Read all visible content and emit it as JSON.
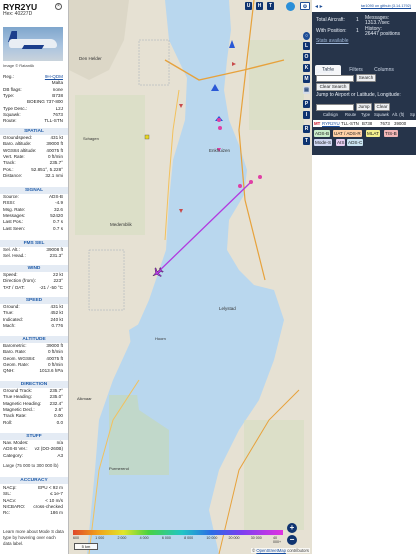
{
  "info": {
    "callsign": "RYR2YU",
    "hex_label": "Hex:",
    "hex": "40227D",
    "photo_credit": "Image © Ratan6k",
    "top_rows": [
      {
        "k": "Reg.:",
        "v": "9H-QDM"
      },
      {
        "k": "",
        "v": "Malta"
      },
      {
        "k": "DB flags:",
        "v": "none"
      },
      {
        "k": "Type:",
        "v": "B738"
      },
      {
        "k": "",
        "v": "BOEING 737-800"
      },
      {
        "k": "Type Desc.:",
        "v": "L2J"
      },
      {
        "k": "Squawk:",
        "v": "7673"
      },
      {
        "k": "Route:",
        "v": "TLL-STN"
      }
    ],
    "sections": {
      "spatial": "SPATIAL",
      "signal": "SIGNAL",
      "fms_sel": "FMS SEL",
      "wind": "WIND",
      "speed": "SPEED",
      "altitude": "ALTITUDE",
      "direction": "DIRECTION",
      "stuff": "STUFF",
      "accuracy": "ACCURACY"
    },
    "spatial": [
      {
        "k": "Groundspeed:",
        "v": "431 kt"
      },
      {
        "k": "Baro. altitude:",
        "v": "39000 ft"
      },
      {
        "k": "WGS84 altitude:",
        "v": "40075 ft"
      },
      {
        "k": "Vert. Rate:",
        "v": "0 ft/min"
      },
      {
        "k": "Track:",
        "v": "235.7°"
      },
      {
        "k": "Pos.:",
        "v": "52.851°, 5.228°"
      },
      {
        "k": "Distance:",
        "v": "32.1 nmi"
      }
    ],
    "signal": [
      {
        "k": "Source:",
        "v": "ADS-B"
      },
      {
        "k": "RSSI:",
        "v": "-4.9"
      },
      {
        "k": "Msg. Rate:",
        "v": "32.6"
      },
      {
        "k": "Messages:",
        "v": "52420"
      },
      {
        "k": "Last Pos.:",
        "v": "0.7 s"
      },
      {
        "k": "Last Seen:",
        "v": "0.7 s"
      }
    ],
    "fms_sel": [
      {
        "k": "Sel. Alt.:",
        "v": "39008 ft"
      },
      {
        "k": "Sel. Head.:",
        "v": "231.3°"
      }
    ],
    "wind": [
      {
        "k": "Speed:",
        "v": "22 kt"
      },
      {
        "k": "Direction (from):",
        "v": "223°"
      },
      {
        "k": "TAT / OAT:",
        "v": "-21 / -50 °C"
      }
    ],
    "speed": [
      {
        "k": "Ground:",
        "v": "431 kt"
      },
      {
        "k": "True:",
        "v": "452 kt"
      },
      {
        "k": "Indicated:",
        "v": "240 kt"
      },
      {
        "k": "Mach:",
        "v": "0.776"
      }
    ],
    "altitude": [
      {
        "k": "Barometric:",
        "v": "39000 ft"
      },
      {
        "k": "Baro. Rate:",
        "v": "0 ft/min"
      },
      {
        "k": "Geom. WGS84:",
        "v": "40075 ft"
      },
      {
        "k": "Geom. Rate:",
        "v": "0 ft/min"
      },
      {
        "k": "QNH:",
        "v": "1013.6 hPa"
      }
    ],
    "direction": [
      {
        "k": "Ground Track:",
        "v": "235.7°"
      },
      {
        "k": "True Heading:",
        "v": "235.0°"
      },
      {
        "k": "Magnetic Heading:",
        "v": "232.4°"
      },
      {
        "k": "Magnetic Decl.:",
        "v": "2.6°"
      },
      {
        "k": "Track Rate:",
        "v": "0.00"
      },
      {
        "k": "Roll:",
        "v": "0.0"
      }
    ],
    "stuff": [
      {
        "k": "Nav. Modes:",
        "v": "n/a"
      },
      {
        "k": "ADS-B Ver.:",
        "v": "v2 (DO-260B)"
      },
      {
        "k": "Category:",
        "v": "A3"
      }
    ],
    "stuff_note": "Large (75 000 to 300 000 lb)",
    "accuracy": [
      {
        "k": "NACp:",
        "v": "EPU < 92 m"
      },
      {
        "k": "SIL:",
        "v": "≤ 1e-7"
      },
      {
        "k": "NACv:",
        "v": "< 10 m/s"
      },
      {
        "k": "NICBARO:",
        "v": "cross-checked"
      },
      {
        "k": "Rc:",
        "v": "186 m"
      }
    ],
    "footer": "Learn more about Mode S data type by hovering over each data label."
  },
  "map": {
    "buttons": [
      "U",
      "H",
      "T"
    ],
    "side_buttons": [
      "L",
      "O",
      "K",
      "M",
      "P",
      "I",
      "R",
      "T"
    ],
    "zoom_in": "+",
    "zoom_out": "−",
    "scale": "5 km",
    "alt_labels": [
      "600",
      "1 000",
      "2 000",
      "4 000",
      "6 000",
      "8 000",
      "10 000",
      "20 000",
      "30 000",
      "40 000+"
    ],
    "attribution_prefix": "©",
    "attribution_link": "OpenStreetMap",
    "attribution_suffix": "contributors",
    "place_labels": [
      "Medemblik",
      "Enkhuizen",
      "Lelystad",
      "Den Helder",
      "Schagen",
      "Alkmaar",
      "Hoorn",
      "Purmerend"
    ],
    "colors": {
      "water": "#b9d7ee",
      "land": "#e9e4d8",
      "track": "#b23ae0"
    }
  },
  "right": {
    "github": "tar1090 on github (3.14.1792)",
    "stats": {
      "total_label": "Total Aircraft:",
      "total": "1",
      "messages_label": "Messages:",
      "messages": "1313.7/sec",
      "withpos_label": "With Position:",
      "withpos": "1",
      "history_label": "History:",
      "history": "26447 positions",
      "stats_available": "Stats available"
    },
    "tabs": [
      "Table",
      "Filters",
      "Columns"
    ],
    "search_label": "Search:",
    "search_button": "Search",
    "clear_search": "Clear Search",
    "jump_label": "Jump to Airport or Latitude, Longitude:",
    "jump_button": "Jump",
    "clear_button": "Clear",
    "table_headers": [
      "Callsign",
      "Route",
      "Type",
      "Squawk",
      "Alt. (ft)",
      "Sp"
    ],
    "row": {
      "flag": "MT",
      "callsign": "RYR2YU",
      "route": "TLL-STN",
      "type": "B738",
      "squawk": "7673",
      "alt": "39000"
    },
    "badges": [
      "ADS-B",
      "UAT / ADS-R",
      "MLAT",
      "TIS-B",
      "Mode-S",
      "AIS",
      "ADS-C"
    ]
  }
}
